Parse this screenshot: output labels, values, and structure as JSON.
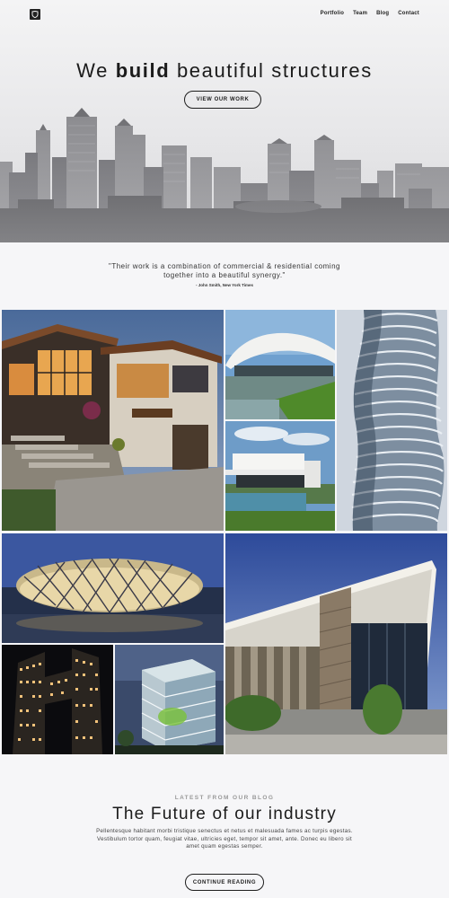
{
  "nav": {
    "logo_icon": "shield-icon",
    "items": [
      "Portfolio",
      "Team",
      "Blog",
      "Contact"
    ]
  },
  "hero": {
    "headline_pre": "We ",
    "headline_bold": "build",
    "headline_post": " beautiful structures",
    "button": "VIEW OUR WORK"
  },
  "quote": {
    "text": "\"Their work is a combination of commercial & residential coming together into a beautiful synergy.\"",
    "cite": "- John Smith, New York Times"
  },
  "gallery": {
    "items": [
      "modern-house-photo",
      "curved-pavilion-photo",
      "twisted-tower-photo",
      "white-villa-photo",
      "birds-nest-stadium-photo",
      "angular-building-photo",
      "lit-skyscraper-photo",
      "glass-cube-photo"
    ]
  },
  "blog": {
    "eyebrow": "LATEST FROM OUR BLOG",
    "title": "The Future of our industry",
    "body": "Pellentesque habitant morbi tristique senectus et netus et malesuada fames ac turpis egestas. Vestibulum tortor quam, feugiat vitae, ultricies eget, tempor sit amet, ante. Donec eu libero sit amet quam egestas semper.",
    "button": "CONTINUE READING"
  },
  "colors": {
    "background": "#f6f6f8",
    "text": "#1b1b1b",
    "muted": "#999999"
  }
}
